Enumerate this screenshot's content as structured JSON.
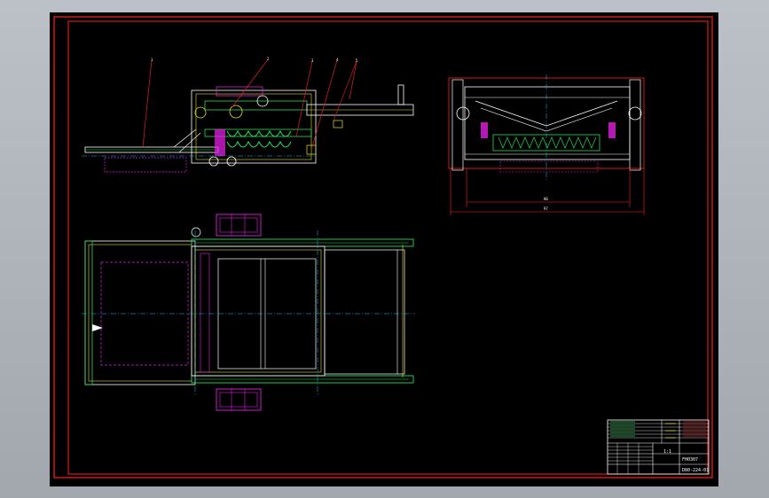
{
  "colors": {
    "viewport_background": "#a7abb2",
    "sheet_background": "#000000",
    "border": "#ff2020",
    "centerline": "#00c8ff",
    "part_outline": "#ffffff",
    "frame_green": "#22e050",
    "hidden_magenta": "#e020e0",
    "leader_red": "#e02020",
    "detail_yellow": "#e8e020"
  },
  "drawing": {
    "balloons": [
      "1",
      "2",
      "3",
      "4",
      "5"
    ],
    "dimensions": {
      "inner_width": "80",
      "overall_width": "97"
    }
  },
  "title_block": {
    "drawing_title": "FH0307",
    "drawing_number": "D80-224-01",
    "scale": "1:1"
  }
}
